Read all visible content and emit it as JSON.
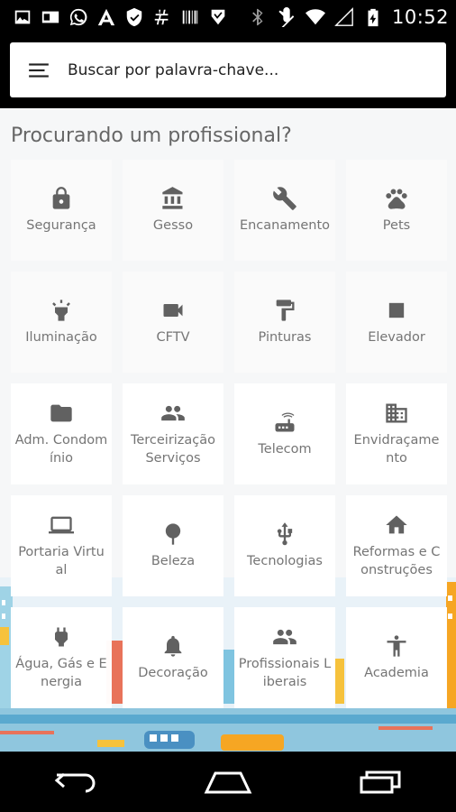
{
  "status_bar": {
    "time": "10:52",
    "left_icons": [
      "image-icon",
      "id-card-icon",
      "whatsapp-icon",
      "app-a-icon",
      "shield-icon",
      "hash-icon",
      "barcode-icon",
      "check-shield-icon"
    ],
    "right_icons": [
      "bluetooth-icon",
      "mute-icon",
      "wifi-icon",
      "signal-icon",
      "battery-charging-icon"
    ]
  },
  "search": {
    "placeholder": "Buscar por palavra-chave...",
    "value": ""
  },
  "main": {
    "title": "Procurando um profissional?"
  },
  "categories": [
    {
      "label": "Segurança",
      "icon": "lock-icon"
    },
    {
      "label": "Gesso",
      "icon": "bank-icon"
    },
    {
      "label": "Encanamento",
      "icon": "wrench-icon"
    },
    {
      "label": "Pets",
      "icon": "paw-icon"
    },
    {
      "label": "Iluminação",
      "icon": "light-icon"
    },
    {
      "label": "CFTV",
      "icon": "videocam-icon"
    },
    {
      "label": "Pinturas",
      "icon": "paint-roller-icon"
    },
    {
      "label": "Elevador",
      "icon": "square-icon"
    },
    {
      "label": "Adm. Condomínio",
      "icon": "folder-icon"
    },
    {
      "label": "Terceirização Serviços",
      "icon": "people-icon"
    },
    {
      "label": "Telecom",
      "icon": "router-icon"
    },
    {
      "label": "Envidraçamento",
      "icon": "building-icon"
    },
    {
      "label": "Portaria Virtual",
      "icon": "laptop-icon"
    },
    {
      "label": "Beleza",
      "icon": "pin-icon"
    },
    {
      "label": "Tecnologias",
      "icon": "usb-icon"
    },
    {
      "label": "Reformas e Construções",
      "icon": "home-icon"
    },
    {
      "label": "Água, Gás e Energia",
      "icon": "plug-icon"
    },
    {
      "label": "Decoração",
      "icon": "bell-icon"
    },
    {
      "label": "Profissionais Liberais",
      "icon": "people-icon"
    },
    {
      "label": "Academia",
      "icon": "accessibility-icon"
    }
  ],
  "colors": {
    "icon": "#616161",
    "label": "#757575",
    "title": "#666666"
  }
}
